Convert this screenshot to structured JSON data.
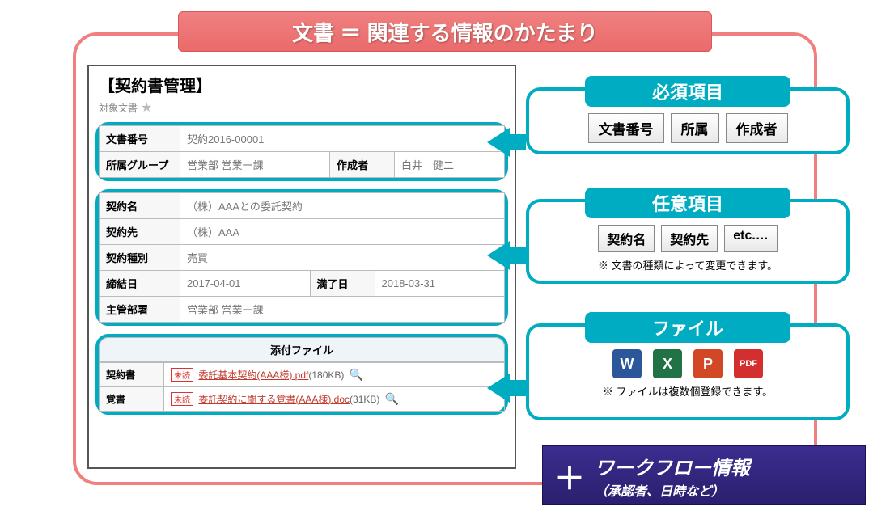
{
  "title": "文書 ＝ 関連する情報のかたまり",
  "doc": {
    "heading": "【契約書管理】",
    "sublabel": "対象文書",
    "group1": {
      "docnum_label": "文書番号",
      "docnum": "契約2016-00001",
      "group_label": "所属グループ",
      "group": "営業部 営業一課",
      "author_label": "作成者",
      "author": "白井　健二"
    },
    "group2": {
      "name_label": "契約名",
      "name": "（株）AAAとの委託契約",
      "party_label": "契約先",
      "party": "（株）AAA",
      "type_label": "契約種別",
      "type": "売買",
      "start_label": "締結日",
      "start": "2017-04-01",
      "end_label": "満了日",
      "end": "2018-03-31",
      "dept_label": "主管部署",
      "dept": "営業部 営業一課"
    },
    "attach": {
      "header": "添付ファイル",
      "badge": "未読",
      "row1_label": "契約書",
      "row1_file": "委託基本契約(AAA様).pdf",
      "row1_size": "(180KB)",
      "row2_label": "覚書",
      "row2_file": "委託契約に関する覚書(AAA様).doc",
      "row2_size": "(31KB)"
    }
  },
  "callouts": {
    "c1": {
      "title": "必須項目",
      "p1": "文書番号",
      "p2": "所属",
      "p3": "作成者"
    },
    "c2": {
      "title": "任意項目",
      "p1": "契約名",
      "p2": "契約先",
      "p3": "etc.…",
      "note": "※ 文書の種類によって変更できます。"
    },
    "c3": {
      "title": "ファイル",
      "note": "※ ファイルは複数個登録できます。"
    }
  },
  "workflow": {
    "plus": "＋",
    "line1": "ワークフロー情報",
    "line2": "（承認者、日時など）"
  },
  "icons": {
    "w": "W",
    "x": "X",
    "p": "P",
    "pdf": "PDF"
  }
}
